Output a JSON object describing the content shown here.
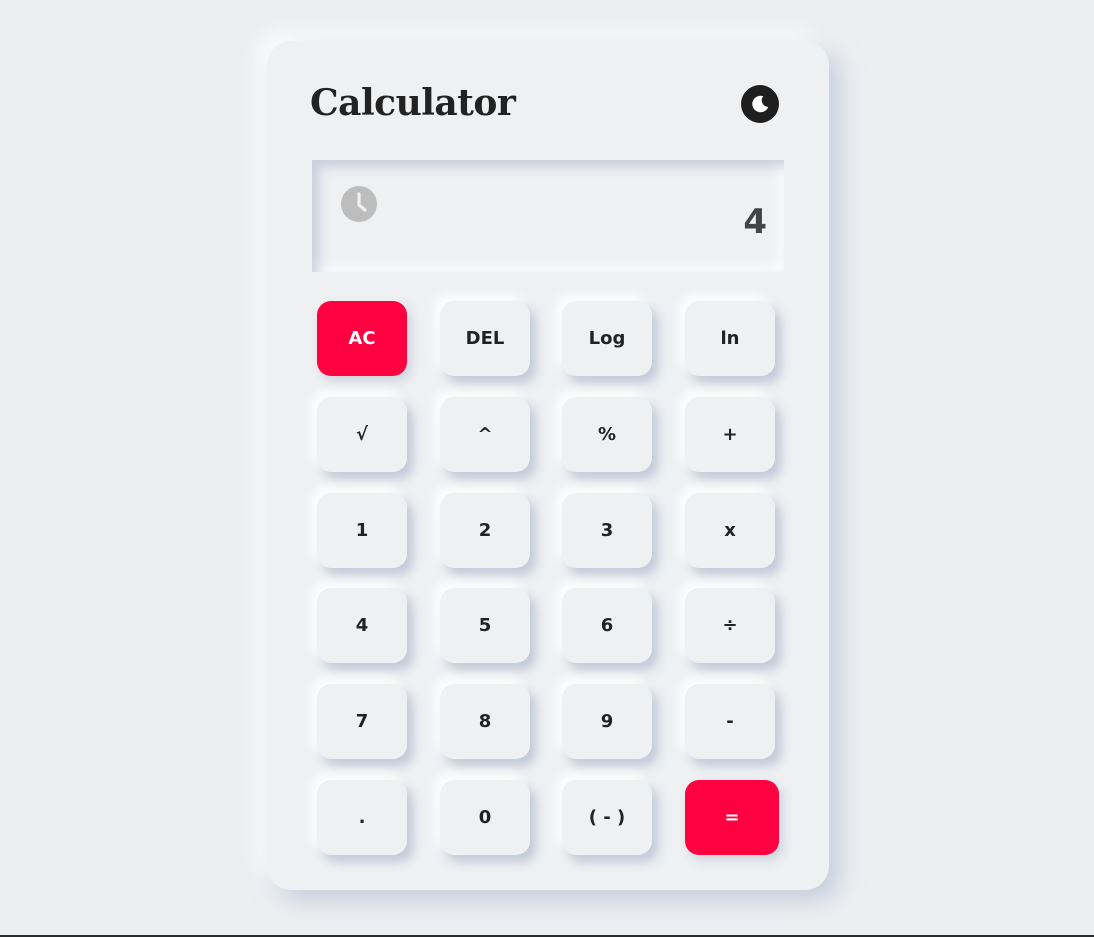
{
  "app": {
    "title": "Calculator"
  },
  "theme_toggle": {
    "icon": "moon-icon"
  },
  "display": {
    "history_icon": "clock-icon",
    "value": "4"
  },
  "colors": {
    "background": "#eceff2",
    "card": "#eef0f2",
    "accent": "#ff0040",
    "text": "#222222",
    "display_text": "#444444",
    "history_icon": "#bdbdbd"
  },
  "keys": {
    "ac": "AC",
    "del": "DEL",
    "log": "Log",
    "ln": "ln",
    "sqrt": "√",
    "power": "^",
    "percent": "%",
    "add": "+",
    "d1": "1",
    "d2": "2",
    "d3": "3",
    "multiply": "x",
    "d4": "4",
    "d5": "5",
    "d6": "6",
    "divide": "÷",
    "d7": "7",
    "d8": "8",
    "d9": "9",
    "subtract": "-",
    "decimal": ".",
    "d0": "0",
    "negate": "( - )",
    "equals": "="
  }
}
